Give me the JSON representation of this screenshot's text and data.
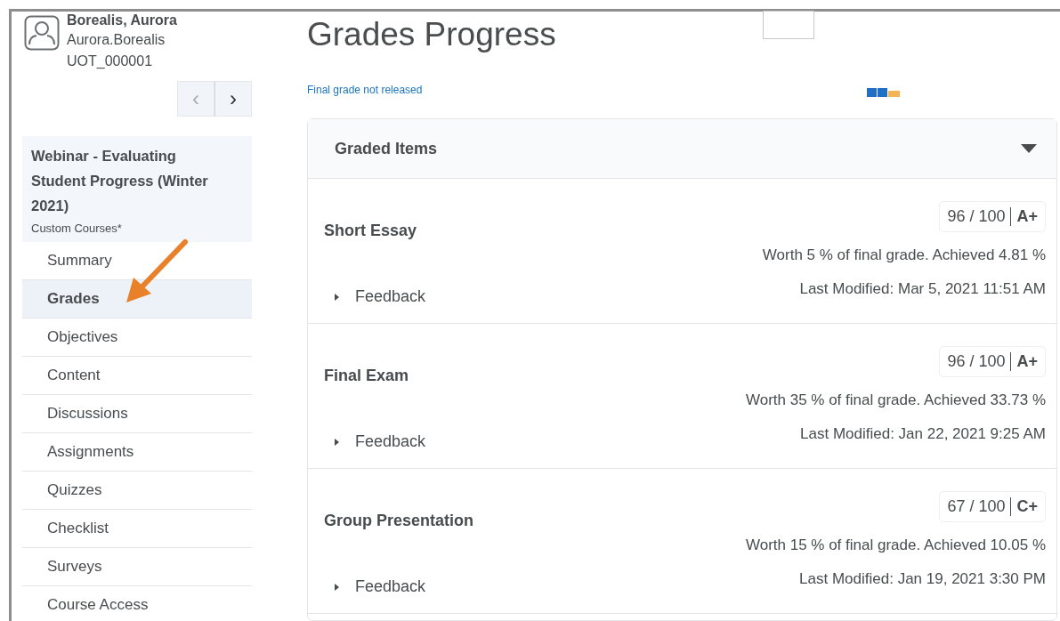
{
  "user": {
    "name": "Borealis, Aurora",
    "username": "Aurora.Borealis",
    "org_id": "UOT_000001"
  },
  "pager": [
    {
      "label": "‹",
      "disabled": true
    },
    {
      "label": "›",
      "disabled": false
    }
  ],
  "course": {
    "title": "Webinar - Evaluating Student Progress (Winter 2021)",
    "subtitle": "Custom Courses*"
  },
  "nav": [
    {
      "label": "Summary",
      "selected": false
    },
    {
      "label": "Grades",
      "selected": true
    },
    {
      "label": "Objectives",
      "selected": false
    },
    {
      "label": "Content",
      "selected": false
    },
    {
      "label": "Discussions",
      "selected": false
    },
    {
      "label": "Assignments",
      "selected": false
    },
    {
      "label": "Quizzes",
      "selected": false
    },
    {
      "label": "Checklist",
      "selected": false
    },
    {
      "label": "Surveys",
      "selected": false
    },
    {
      "label": "Course Access",
      "selected": false
    }
  ],
  "page_title": "Grades Progress",
  "status_link": "Final grade not released",
  "panel": {
    "title": "Graded Items",
    "expanded": true
  },
  "items": [
    {
      "name": "Short Essay",
      "score": "96 / 100",
      "letter": "A+",
      "worth": "Worth 5 % of final grade. Achieved 4.81 %",
      "modified": "Last Modified: Mar 5, 2021 11:51 AM",
      "feedback": "Feedback"
    },
    {
      "name": "Final Exam",
      "score": "96 / 100",
      "letter": "A+",
      "worth": "Worth 35 % of final grade. Achieved 33.73 %",
      "modified": "Last Modified: Jan 22, 2021 9:25 AM",
      "feedback": "Feedback"
    },
    {
      "name": "Group Presentation",
      "score": "67 / 100",
      "letter": "C+",
      "worth": "Worth 15 % of final grade. Achieved 10.05 %",
      "modified": "Last Modified: Jan 19, 2021 3:30 PM",
      "feedback": "Feedback"
    }
  ]
}
